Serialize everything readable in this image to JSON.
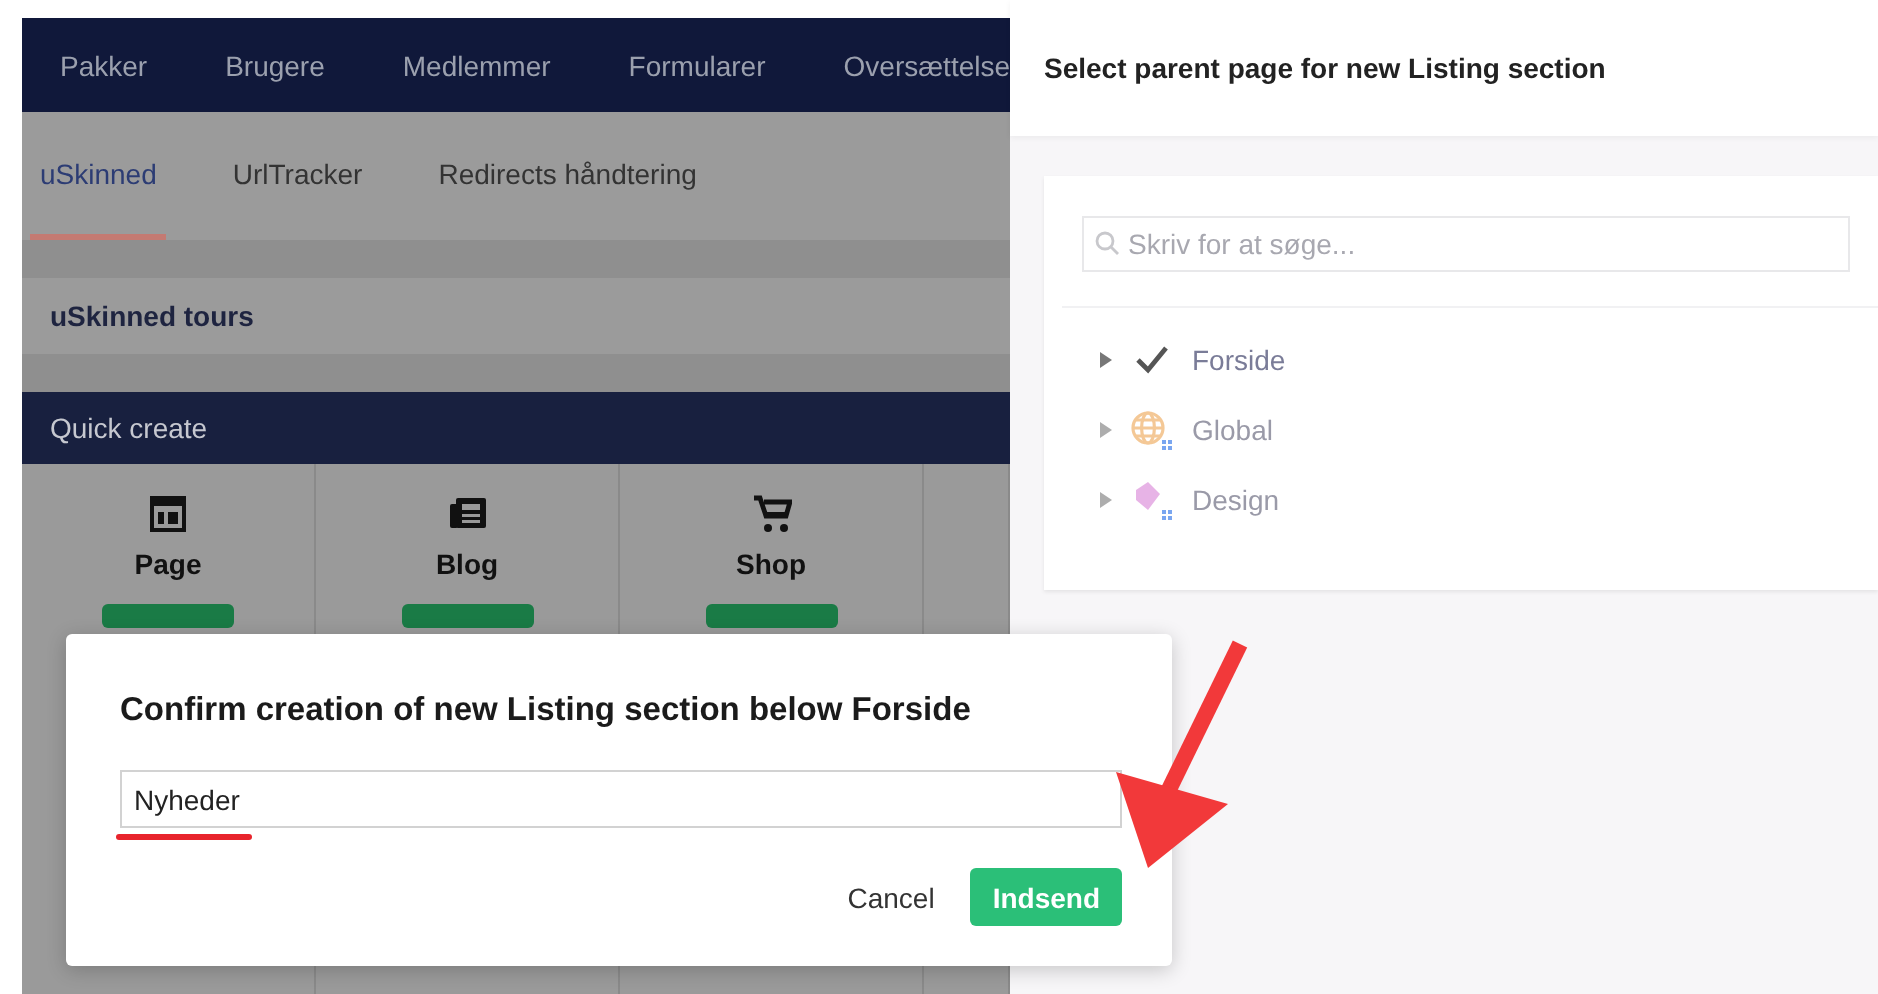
{
  "top_nav": {
    "items": [
      "Pakker",
      "Brugere",
      "Medlemmer",
      "Formularer",
      "Oversættelse"
    ]
  },
  "sub_tabs": [
    {
      "label": "uSkinned",
      "selected": true
    },
    {
      "label": "UrlTracker",
      "selected": false
    },
    {
      "label": "Redirects håndtering",
      "selected": false
    }
  ],
  "tours_panel": {
    "title": "uSkinned tours"
  },
  "quick_create": {
    "title": "Quick create",
    "items": [
      {
        "label": "Page",
        "kind": "page"
      },
      {
        "label": "Blog",
        "kind": "blog"
      },
      {
        "label": "Shop",
        "kind": "shop"
      }
    ]
  },
  "parent_picker": {
    "title": "Select parent page for new Listing section",
    "search": {
      "placeholder": "Skriv for at søge..."
    },
    "tree": [
      {
        "label": "Forside",
        "kind": "selected-page",
        "disabled": false,
        "expanded": false
      },
      {
        "label": "Global",
        "kind": "globe",
        "disabled": true,
        "expanded": false
      },
      {
        "label": "Design",
        "kind": "design",
        "disabled": true,
        "expanded": false
      }
    ]
  },
  "dialog": {
    "title": "Confirm creation of new Listing section below Forside",
    "field": {
      "value": "Nyheder"
    },
    "buttons": [
      {
        "label": "Cancel",
        "kind": "link"
      },
      {
        "label": "Indsend",
        "kind": "primary"
      }
    ]
  }
}
